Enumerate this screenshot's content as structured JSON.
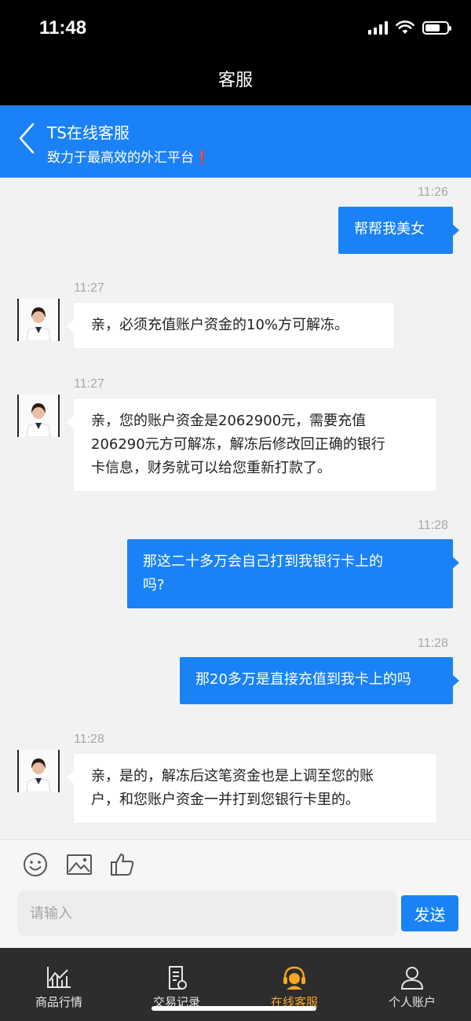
{
  "status_bar": {
    "time": "11:48"
  },
  "title_bar": {
    "title": "客服"
  },
  "chat_header": {
    "name": "TS在线客服",
    "subtitle": "致力于最高效的外汇平台",
    "subtitle_mark": "❗"
  },
  "messages": [
    {
      "time": "11:26",
      "direction": "out",
      "lines": [
        "帮帮我美女"
      ]
    },
    {
      "time": "11:27",
      "direction": "in",
      "lines": [
        "亲，必须充值账户资金的10%方可解冻。"
      ]
    },
    {
      "time": "11:27",
      "direction": "in",
      "lines": [
        "亲，您的账户资金是2062900元，需要充值",
        "206290元方可解冻，解冻后修改回正确的银行",
        "卡信息，财务就可以给您重新打款了。"
      ]
    },
    {
      "time": "11:28",
      "direction": "out",
      "lines": [
        "那这二十多万会自己打到我银行卡上的",
        "吗?"
      ]
    },
    {
      "time": "11:28",
      "direction": "out",
      "lines": [
        "那20多万是直接充值到我卡上的吗"
      ]
    },
    {
      "time": "11:28",
      "direction": "in",
      "lines": [
        "亲，是的，解冻后这笔资金也是上调至您的账",
        "户，和您账户资金一并打到您银行卡里的。"
      ]
    }
  ],
  "input": {
    "placeholder": "请输入",
    "value": "",
    "send_label": "发送"
  },
  "toolbar_icons": [
    "emoji-icon",
    "image-icon",
    "thumbs-up-icon"
  ],
  "tabs": [
    {
      "label": "商品行情",
      "icon": "chart-icon",
      "active": false
    },
    {
      "label": "交易记录",
      "icon": "document-icon",
      "active": false
    },
    {
      "label": "在线客服",
      "icon": "headset-icon",
      "active": true
    },
    {
      "label": "个人账户",
      "icon": "user-icon",
      "active": false
    }
  ],
  "colors": {
    "accent": "#1a82f6",
    "active_tab": "#f5a623",
    "bubble_in": "#ffffff",
    "chat_bg": "#f2f2f2",
    "tab_bar": "#2d2d2d"
  }
}
